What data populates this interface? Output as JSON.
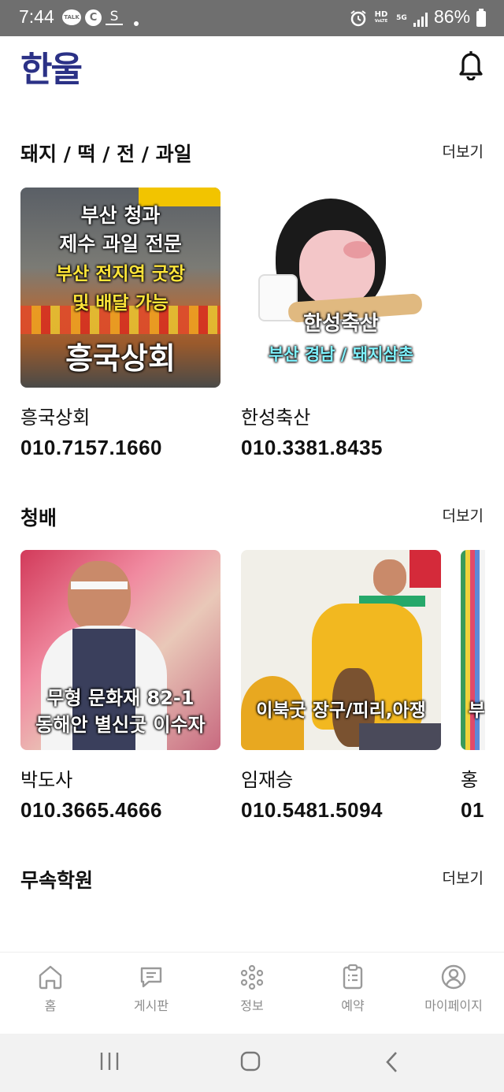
{
  "status_bar": {
    "time": "7:44",
    "talk": "TALK",
    "c": "C",
    "s": "S",
    "hd": "HD",
    "voice": "VoLTE",
    "network": "5G",
    "battery": "86%"
  },
  "header": {
    "logo": "한울"
  },
  "sections": [
    {
      "title": "돼지 / 떡 / 전 / 과일",
      "more": "더보기",
      "cards": [
        {
          "name": "흥국상회",
          "phone": "010.7157.1660",
          "overlay": [
            "부산 청과",
            "제수 과일 전문",
            "부산 전지역 굿장",
            "및 배달 가능",
            "흥국상회"
          ]
        },
        {
          "name": "한성축산",
          "phone": "010.3381.8435",
          "overlay": [
            "한성축산",
            "부산 경남 / 돼지삼촌"
          ]
        }
      ]
    },
    {
      "title": "청배",
      "more": "더보기",
      "cards": [
        {
          "name": "박도사",
          "phone": "010.3665.4666",
          "overlay": [
            "무형 문화재 82-1",
            "동해안 별신굿 이수자"
          ]
        },
        {
          "name": "임재승",
          "phone": "010.5481.5094",
          "overlay": [
            "이북굿 장구/피리,아쟁"
          ]
        },
        {
          "name": "홍",
          "phone": "01",
          "overlay": [
            "부"
          ]
        }
      ]
    },
    {
      "title": "무속학원",
      "more": "더보기"
    }
  ],
  "bottom_nav": {
    "items": [
      {
        "label": "홈",
        "icon": "home-icon"
      },
      {
        "label": "게시판",
        "icon": "board-icon"
      },
      {
        "label": "정보",
        "icon": "info-icon"
      },
      {
        "label": "예약",
        "icon": "reservation-icon"
      },
      {
        "label": "마이페이지",
        "icon": "mypage-icon"
      }
    ]
  },
  "colors": {
    "brand": "#2b3186",
    "status_bar": "#6f6f6f",
    "nav_inactive": "#9a9a9a"
  }
}
